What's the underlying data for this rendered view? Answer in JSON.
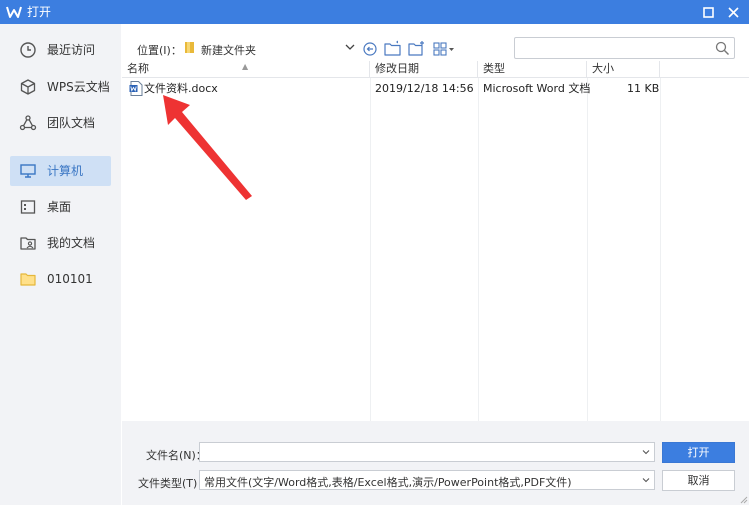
{
  "window": {
    "title": "打开",
    "logo_icon": "wps-logo-icon",
    "maximize_icon": "maximize-icon",
    "close_icon": "close-icon",
    "accent_color": "#3c7ee0"
  },
  "sidebar": {
    "items": [
      {
        "label": "最近访问",
        "icon": "clock-icon",
        "active": false
      },
      {
        "label": "WPS云文档",
        "icon": "cube-icon",
        "active": false
      },
      {
        "label": "团队文档",
        "icon": "team-icon",
        "active": false
      },
      {
        "label": "计算机",
        "icon": "computer-icon",
        "active": true
      },
      {
        "label": "桌面",
        "icon": "desktop-icon",
        "active": false
      },
      {
        "label": "我的文档",
        "icon": "my-documents-icon",
        "active": false
      },
      {
        "label": "010101",
        "icon": "folder-icon",
        "active": false
      }
    ]
  },
  "toolbar": {
    "location_label": "位置(I)：",
    "location_value": "新建文件夹",
    "back_icon": "back-arrow-icon",
    "up_icon": "folder-up-icon",
    "new_folder_icon": "new-folder-icon",
    "view_icon": "view-grid-icon",
    "search_placeholder": "",
    "search_icon": "search-icon"
  },
  "file_list": {
    "columns": [
      "名称",
      "修改日期",
      "类型",
      "大小"
    ],
    "rows": [
      {
        "name": "文件资料.docx",
        "modified": "2019/12/18 14:56",
        "type": "Microsoft Word 文档",
        "size": "11 KB",
        "icon": "word-doc-icon"
      }
    ]
  },
  "bottom": {
    "filename_label": "文件名(N)：",
    "filename_value": "",
    "filetype_label": "文件类型(T)：",
    "filetype_value": "常用文件(文字/Word格式,表格/Excel格式,演示/PowerPoint格式,PDF文件)",
    "open_label": "打开",
    "cancel_label": "取消"
  },
  "annotation": {
    "arrow_icon": "red-arrow-icon",
    "color": "#ee3333"
  }
}
